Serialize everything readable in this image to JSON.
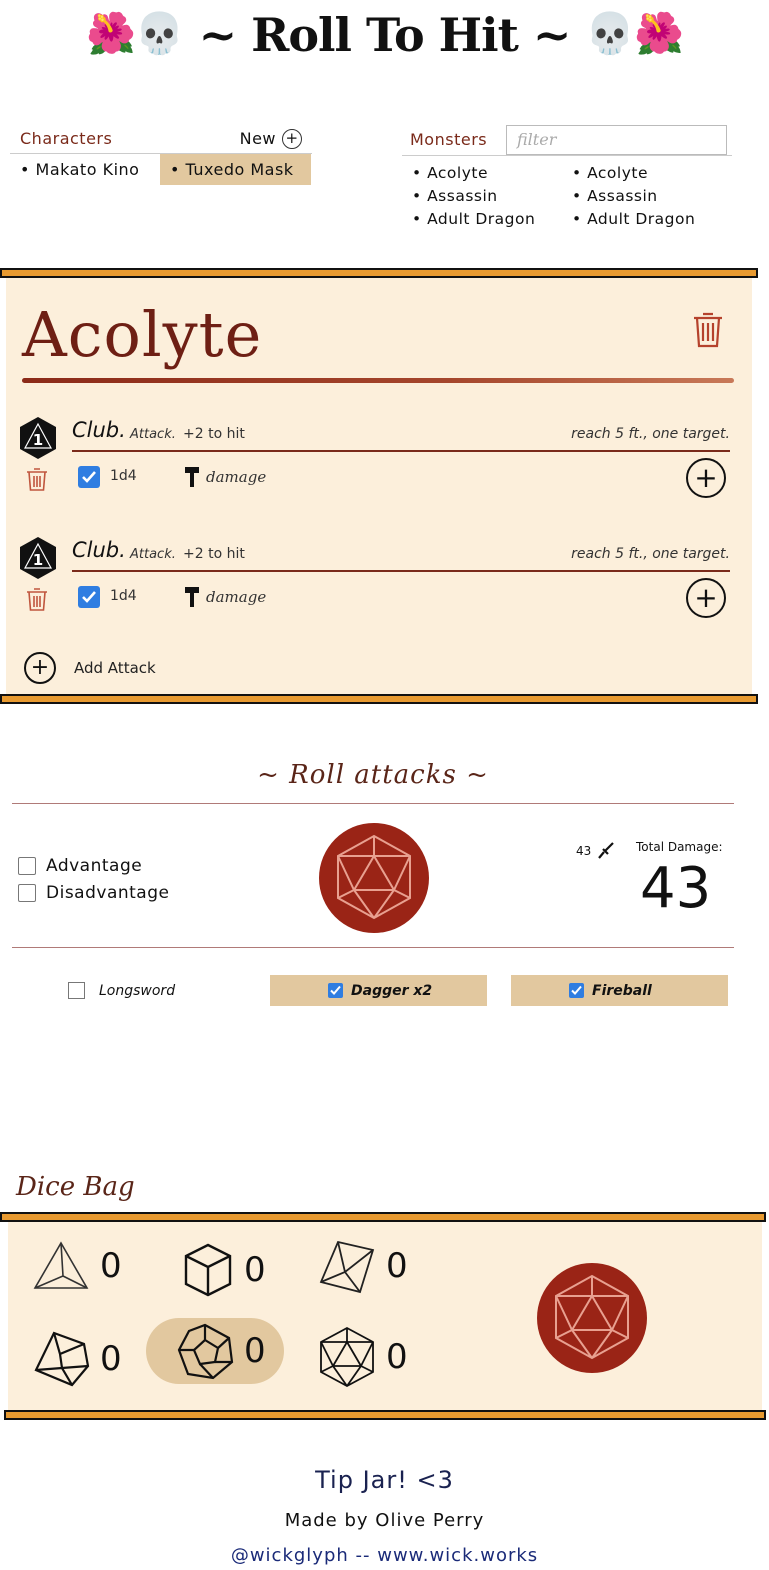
{
  "header": {
    "title": "~ Roll To Hit ~",
    "left_emoji": "🌺💀",
    "right_emoji": "💀🌺"
  },
  "characters": {
    "label": "Characters",
    "new_label": "New",
    "items": [
      {
        "name": "• Makato Kino",
        "selected": false
      },
      {
        "name": "• Tuxedo Mask",
        "selected": true
      }
    ]
  },
  "monsters": {
    "label": "Monsters",
    "filter_placeholder": "filter",
    "col1": [
      "• Acolyte",
      "• Assassin",
      "• Adult Dragon"
    ],
    "col2": [
      "• Acolyte",
      "• Assassin",
      "• Adult Dragon"
    ]
  },
  "monster_card": {
    "name": "Acolyte",
    "attacks": [
      {
        "die_label": "1",
        "name": "Club.",
        "type": "Attack.",
        "to_hit": "+2 to hit",
        "reach": "reach 5 ft., one target.",
        "dice": "1d4",
        "damage_label": "damage",
        "checked": true
      },
      {
        "die_label": "1",
        "name": "Club.",
        "type": "Attack.",
        "to_hit": "+2 to hit",
        "reach": "reach 5 ft., one target.",
        "dice": "1d4",
        "damage_label": "damage",
        "checked": true
      }
    ],
    "add_attack_label": "Add Attack"
  },
  "roll_attacks": {
    "title": "~ Roll attacks ~",
    "advantage_label": "Advantage",
    "disadvantage_label": "Disadvantage",
    "small_total": "43",
    "total_label": "Total Damage:",
    "total_value": "43",
    "selections": [
      {
        "label": "Longsword",
        "checked": false
      },
      {
        "label": "Dagger x2",
        "checked": true
      },
      {
        "label": "Fireball",
        "checked": true
      }
    ]
  },
  "dice_bag": {
    "title": "Dice Bag",
    "dice": [
      {
        "icon": "d4-icon",
        "count": "0"
      },
      {
        "icon": "d6-icon",
        "count": "0"
      },
      {
        "icon": "d8-icon",
        "count": "0"
      },
      {
        "icon": "d10-icon",
        "count": "0"
      },
      {
        "icon": "d12-icon",
        "count": "0",
        "selected": true
      },
      {
        "icon": "d20-icon",
        "count": "0"
      }
    ]
  },
  "footer": {
    "tip": "Tip Jar! <3",
    "made_by": "Made by Olive Perry",
    "links": "@wickglyph -- www.wick.works"
  },
  "colors": {
    "accent_orange": "#e89a30",
    "card_bg": "#fcefdb",
    "selected_bg": "#e2c89f",
    "maroon": "#6e1f14",
    "roll_red": "#9a2416",
    "check_blue": "#2f7de1"
  }
}
